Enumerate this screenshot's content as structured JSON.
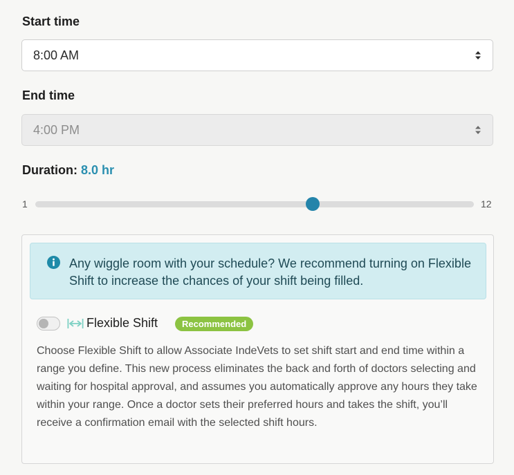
{
  "start_time": {
    "label": "Start time",
    "value": "8:00 AM"
  },
  "end_time": {
    "label": "End time",
    "value": "4:00 PM"
  },
  "duration": {
    "label": "Duration:",
    "value_text": "8.0 hr",
    "slider_min": "1",
    "slider_max": "12",
    "slider_value": 8
  },
  "flexible_shift": {
    "alert_text": "Any wiggle room with your schedule? We recommend turning on Flexible Shift to increase the chances of your shift being filled.",
    "toggle_label": "Flexible Shift",
    "toggle_on": false,
    "badge": "Recommended",
    "description": "Choose Flexible Shift to allow Associate IndeVets to set shift start and end time within a range you define. This new process eliminates the back and forth of doctors selecting and waiting for hospital approval, and assumes you automatically approve any hours they take within your range. Once a doctor sets their preferred hours and takes the shift, you’ll receive a confirmation email with the selected shift hours."
  },
  "icons": {
    "caret": "sort-caret-icon",
    "info": "info-icon",
    "flex": "flex-arrows-icon"
  },
  "colors": {
    "accent": "#2484aa",
    "duration_value": "#2a8fb0",
    "alert_bg": "#d2edf1",
    "badge_bg": "#8cc342"
  }
}
